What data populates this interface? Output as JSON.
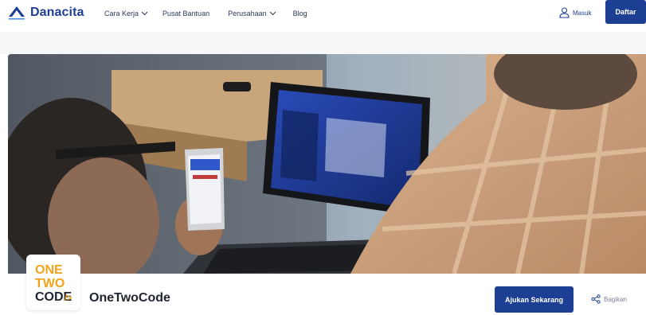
{
  "brand": {
    "name": "Danacita",
    "color": "#1d3f93"
  },
  "nav": {
    "items": [
      {
        "label": "Cara Kerja",
        "has_dropdown": true
      },
      {
        "label": "Pusat Bantuan",
        "has_dropdown": false
      },
      {
        "label": "Perusahaan",
        "has_dropdown": true
      },
      {
        "label": "Blog",
        "has_dropdown": false
      }
    ],
    "login_label": "Masuk",
    "signup_label": "Daftar"
  },
  "company": {
    "logo_lines": [
      "ONE",
      "TWO",
      "CODE"
    ],
    "logo_suffix": "/>",
    "name": "OneTwoCode"
  },
  "actions": {
    "apply_label": "Ajukan Sekarang",
    "share_label": "Bagikan"
  },
  "colors": {
    "primary": "#1d3f93",
    "logo_orange": "#f2a31b",
    "logo_dark": "#1f2430"
  }
}
